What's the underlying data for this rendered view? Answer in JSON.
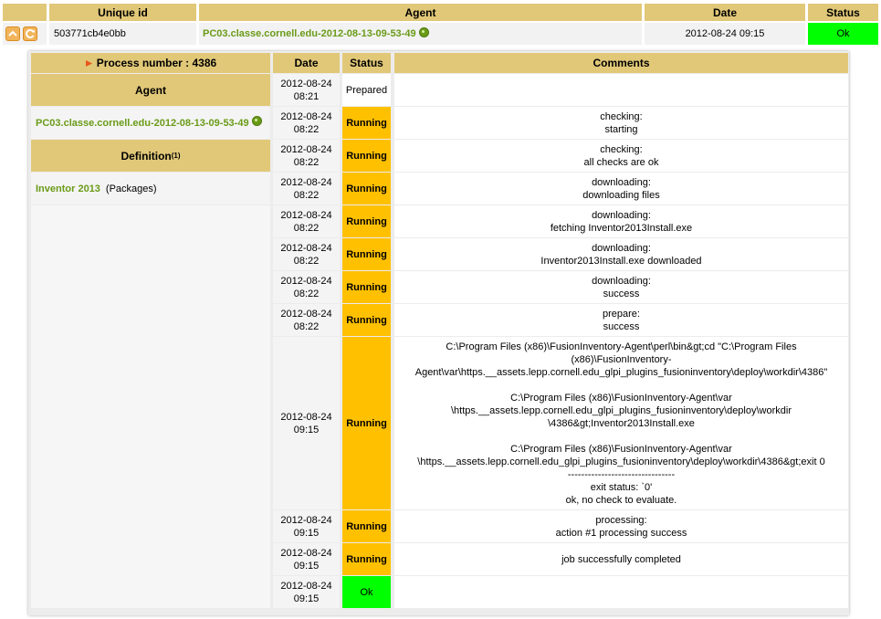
{
  "top": {
    "headers": {
      "unique_id": "Unique id",
      "agent": "Agent",
      "date": "Date",
      "status": "Status"
    },
    "row": {
      "unique_id": "503771cb4e0bb",
      "agent": "PC03.classe.cornell.edu-2012-08-13-09-53-49",
      "date": "2012-08-24 09:15",
      "status": "Ok"
    }
  },
  "detail": {
    "process_title": "Process number : 4386",
    "agent_header": "Agent",
    "agent_value": "PC03.classe.cornell.edu-2012-08-13-09-53-49",
    "definition_header": "Definition",
    "definition_sup": "(1)",
    "definition_name": "Inventor 2013",
    "definition_type": "(Packages)",
    "col_headers": {
      "date": "Date",
      "status": "Status",
      "comments": "Comments"
    },
    "rows": [
      {
        "date": "2012-08-24\n08:21",
        "status": "Prepared",
        "comment": ""
      },
      {
        "date": "2012-08-24\n08:22",
        "status": "Running",
        "comment": "checking:\nstarting"
      },
      {
        "date": "2012-08-24\n08:22",
        "status": "Running",
        "comment": "checking:\nall checks are ok"
      },
      {
        "date": "2012-08-24\n08:22",
        "status": "Running",
        "comment": "downloading:\ndownloading files"
      },
      {
        "date": "2012-08-24\n08:22",
        "status": "Running",
        "comment": "downloading:\nfetching Inventor2013Install.exe"
      },
      {
        "date": "2012-08-24\n08:22",
        "status": "Running",
        "comment": "downloading:\nInventor2013Install.exe downloaded"
      },
      {
        "date": "2012-08-24\n08:22",
        "status": "Running",
        "comment": "downloading:\nsuccess"
      },
      {
        "date": "2012-08-24\n08:22",
        "status": "Running",
        "comment": "prepare:\nsuccess"
      },
      {
        "date": "2012-08-24\n09:15",
        "status": "Running",
        "comment": "C:\\Program Files (x86)\\FusionInventory-Agent\\perl\\bin&gt;cd \"C:\\Program Files (x86)\\FusionInventory-\nAgent\\var\\https.__assets.lepp.cornell.edu_glpi_plugins_fusioninventory\\deploy\\workdir\\4386\"\n\nC:\\Program Files (x86)\\FusionInventory-Agent\\var\n\\https.__assets.lepp.cornell.edu_glpi_plugins_fusioninventory\\deploy\\workdir\n\\4386&gt;Inventor2013Install.exe\n\nC:\\Program Files (x86)\\FusionInventory-Agent\\var\n\\https.__assets.lepp.cornell.edu_glpi_plugins_fusioninventory\\deploy\\workdir\\4386&gt;exit 0\n--------------------------------\nexit status: `0'\nok, no check to evaluate."
      },
      {
        "date": "2012-08-24\n09:15",
        "status": "Running",
        "comment": "processing:\naction #1 processing success"
      },
      {
        "date": "2012-08-24\n09:15",
        "status": "Running",
        "comment": "job successfully completed"
      },
      {
        "date": "2012-08-24\n09:15",
        "status": "Ok",
        "comment": ""
      }
    ]
  },
  "colors": {
    "header": "#e1c878",
    "running": "#ffc000",
    "ok": "#00ff00",
    "link": "#6a9b18"
  },
  "icons": {
    "expand": "expand-icon",
    "refresh": "refresh-icon",
    "agent_link": "agent-link-icon",
    "triangle": "triangle-icon"
  }
}
